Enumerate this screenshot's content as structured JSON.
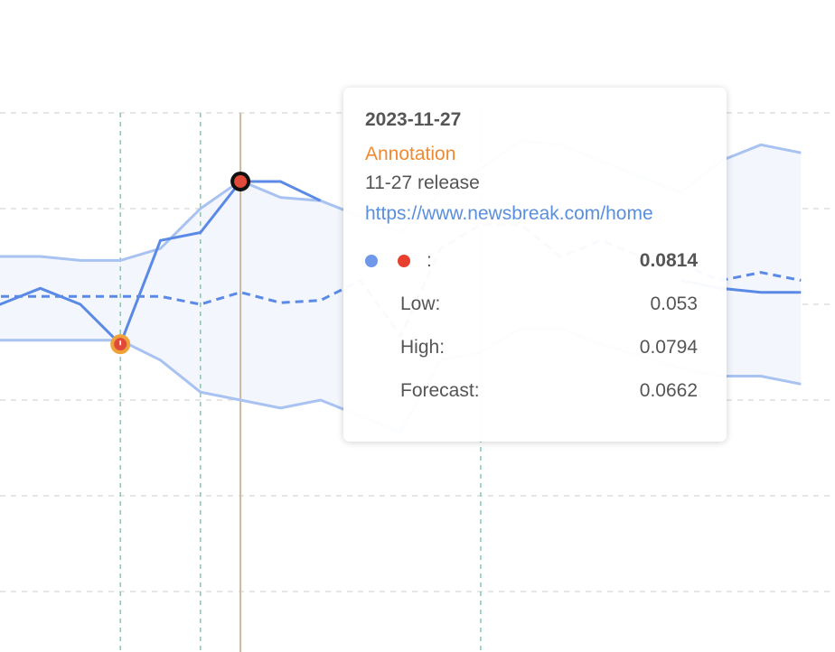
{
  "chart_data": {
    "type": "line",
    "x": [
      1,
      2,
      3,
      4,
      5,
      6,
      7,
      8,
      9,
      10,
      11,
      12,
      13,
      14,
      15,
      16,
      17,
      18,
      19,
      20,
      21
    ],
    "ylim": [
      0.03,
      0.09
    ],
    "grid": true,
    "series": [
      {
        "values": [
          0.069,
          0.066,
          0.068,
          0.066,
          0.061,
          0.074,
          0.075,
          0.0814,
          0.0814,
          0.079,
          null,
          null,
          null,
          null,
          null,
          null,
          null,
          null,
          0.069,
          0.068,
          0.0675,
          0.0675
        ]
      },
      {
        "values": [
          0.067,
          0.067,
          0.067,
          0.067,
          0.067,
          0.067,
          0.066,
          0.0675,
          0.0662,
          0.0665,
          0.069,
          0.062,
          0.073,
          0.076,
          0.076,
          0.072,
          0.074,
          0.072,
          0.071,
          0.069,
          0.07,
          0.069
        ]
      },
      {
        "values": [
          0.072,
          0.072,
          0.072,
          0.0715,
          0.0715,
          0.073,
          0.078,
          0.0815,
          0.0794,
          0.079,
          0.077,
          0.075,
          0.08,
          0.083,
          0.0865,
          0.086,
          0.084,
          0.082,
          0.08,
          0.084,
          0.086,
          0.085
        ]
      },
      {
        "values": [
          0.061,
          0.0615,
          0.0615,
          0.0615,
          0.0615,
          0.059,
          0.055,
          0.054,
          0.053,
          0.054,
          0.052,
          0.05,
          0.059,
          0.06,
          0.063,
          0.063,
          0.061,
          0.0595,
          0.058,
          0.057,
          0.057,
          0.056
        ]
      }
    ],
    "markers": {
      "annotation_index": 4,
      "hover_index": 7,
      "annotation_vlines": [
        4,
        6,
        13
      ]
    }
  },
  "tooltip": {
    "date": "2023-11-27",
    "annotation_title": "Annotation",
    "annotation_text": "11-27 release",
    "link": "https://www.newsbreak.com/home",
    "main_label": ":",
    "main_value": "0.0814",
    "low_label": "Low:",
    "low_value": "0.053",
    "high_label": "High:",
    "high_value": "0.0794",
    "forecast_label": "Forecast:",
    "forecast_value": "0.0662",
    "dot_colors": [
      "#6f97ea",
      "#e8402f"
    ]
  },
  "colors": {
    "line": "#5b8ae6",
    "band": "#a8c2f2",
    "band_fill": "#f3f6fd",
    "grid": "#d8d8d8",
    "annotation_line": "#74c9a8",
    "hover_line": "#c8b9a0",
    "annotation_marker": "#f0a23a",
    "annotation_marker_inner": "#e04a3a"
  }
}
